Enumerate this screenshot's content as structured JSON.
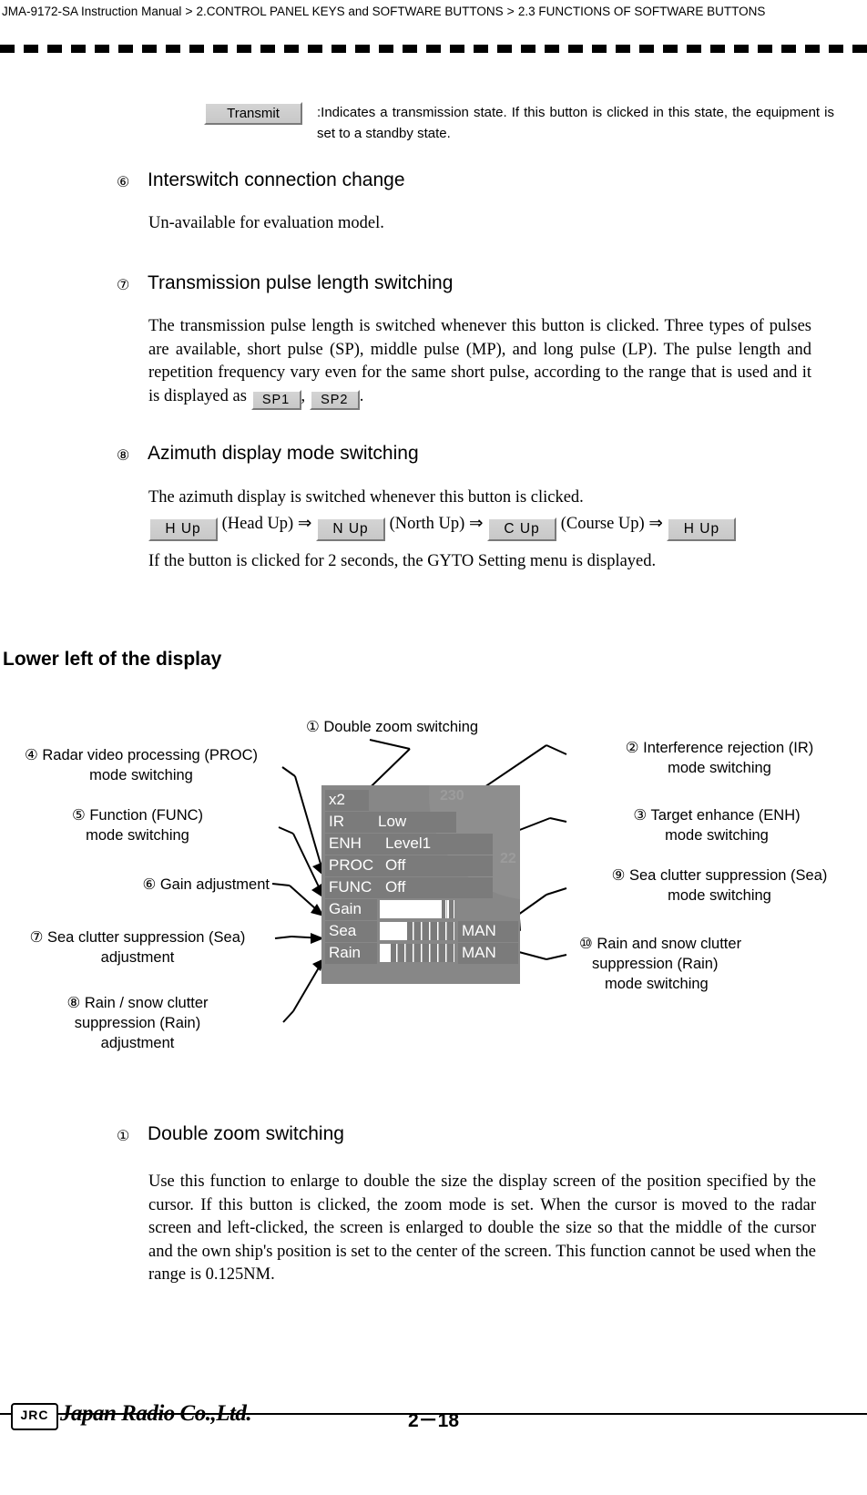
{
  "header": {
    "breadcrumb": [
      "JMA-9172-SA Instruction Manual",
      "2.CONTROL PANEL KEYS and SOFTWARE BUTTONS",
      "2.3  FUNCTIONS OF SOFTWARE BUTTONS"
    ],
    "separator": ">"
  },
  "transmit": {
    "button_label": "Transmit",
    "description": ":Indicates a transmission state. If this button is clicked in this state, the equipment is set to a standby state."
  },
  "sections": {
    "s6": {
      "number": "⑥",
      "title": "Interswitch connection change",
      "body": "Un-available for evaluation model."
    },
    "s7": {
      "number": "⑦",
      "title": "Transmission pulse length switching",
      "body_a": "The transmission pulse length is switched whenever this button is clicked. Three types of pulses are available, short pulse (SP), middle pulse (MP), and long pulse (LP). The pulse length and repetition frequency vary even for the same short pulse, according to the range that is used and it is displayed as",
      "btn_sp1": "SP1",
      "comma": ",",
      "btn_sp2": "SP2",
      "period": "."
    },
    "s8": {
      "number": "⑧",
      "title": "Azimuth display mode switching",
      "body_a": "The azimuth display is switched whenever this button is clicked.",
      "chain": {
        "b1": "H Up",
        "t1": "(Head Up)",
        "arrow1": "⇒",
        "b2": "N Up",
        "t2": "(North Up)",
        "arrow2": "⇒",
        "b3": "C Up",
        "t3": "(Course Up)",
        "arrow3": "⇒",
        "b4": "H Up"
      },
      "body_b": "If the button is clicked for 2 seconds, the GYTO Setting menu is displayed."
    },
    "lower_left_heading": "Lower left of the display",
    "s1": {
      "number": "①",
      "title": "Double zoom switching",
      "body": "Use this function to enlarge to double the size the display screen of the position specified by the cursor.  If this button is clicked, the zoom mode is set. When the cursor is moved to the radar screen and left-clicked, the screen is enlarged to double the size so that the middle of the cursor and the own ship's position is set to the center of the screen. This function cannot be used when the range is 0.125NM."
    }
  },
  "diagram": {
    "callouts": {
      "top": {
        "number": "①",
        "text": "Double zoom switching"
      },
      "left": [
        {
          "number": "④",
          "line1": "Radar video processing (PROC)",
          "line2": "mode switching"
        },
        {
          "number": "⑤",
          "line1": "Function (FUNC)",
          "line2": "mode switching"
        },
        {
          "number": "⑥",
          "line1": "Gain adjustment",
          "line2": ""
        },
        {
          "number": "⑦",
          "line1": "Sea clutter suppression (Sea)",
          "line2": "adjustment"
        },
        {
          "number": "⑧",
          "line1": "Rain / snow clutter",
          "line2": "suppression (Rain)",
          "line3": "adjustment"
        }
      ],
      "right": [
        {
          "number": "②",
          "line1": "Interference rejection (IR)",
          "line2": "mode switching"
        },
        {
          "number": "③",
          "line1": "Target enhance (ENH)",
          "line2": "mode switching"
        },
        {
          "number": "⑨",
          "line1": "Sea clutter suppression (Sea)",
          "line2": "mode switching"
        },
        {
          "number": "⑩",
          "line1": "Rain and snow clutter",
          "line2": "suppression (Rain)",
          "line3": "mode switching"
        }
      ]
    },
    "radar_panel": {
      "zoom_label": "x2",
      "rows": [
        {
          "label": "IR",
          "value": "Low"
        },
        {
          "label": "ENH",
          "value": "Level1"
        },
        {
          "label": "PROC",
          "value": "Off"
        },
        {
          "label": "FUNC",
          "value": "Off"
        }
      ],
      "sliders": [
        {
          "label": "Gain",
          "fill_percent": 88,
          "mode": ""
        },
        {
          "label": "Sea",
          "fill_percent": 36,
          "mode": "MAN"
        },
        {
          "label": "Rain",
          "fill_percent": 14,
          "mode": "MAN"
        }
      ],
      "bearing_top": "230",
      "bearing_right": "22"
    }
  },
  "footer": {
    "page": "2－18",
    "logo_text": "JRC",
    "company": "Japan Radio Co.,Ltd."
  }
}
